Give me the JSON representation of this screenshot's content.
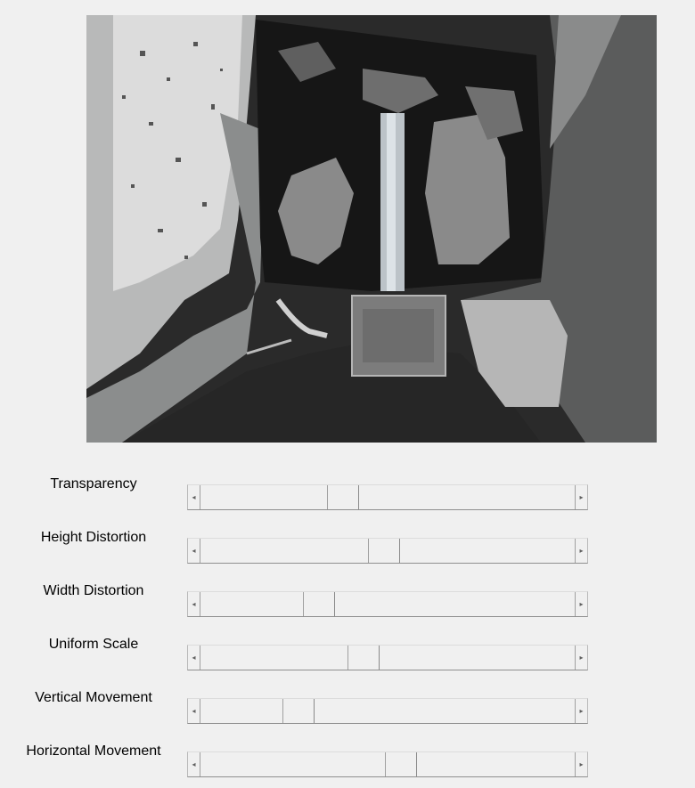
{
  "camera_preview": {
    "icon": "depth-camera-feed"
  },
  "sliders": [
    {
      "id": "transparency",
      "label": "Transparency",
      "value": 0.37
    },
    {
      "id": "height-distortion",
      "label": "Height Distortion",
      "value": 0.49
    },
    {
      "id": "width-distortion",
      "label": "Width Distortion",
      "value": 0.3
    },
    {
      "id": "uniform-scale",
      "label": "Uniform Scale",
      "value": 0.43
    },
    {
      "id": "vertical-movement",
      "label": "Vertical Movement",
      "value": 0.24
    },
    {
      "id": "horizontal-movement",
      "label": "Horizontal Movement",
      "value": 0.54
    }
  ],
  "icons": {
    "left_arrow": "◂",
    "right_arrow": "▸"
  },
  "colors": {
    "background": "#f0f0f0",
    "scroll_border": "#a0a0a0"
  }
}
